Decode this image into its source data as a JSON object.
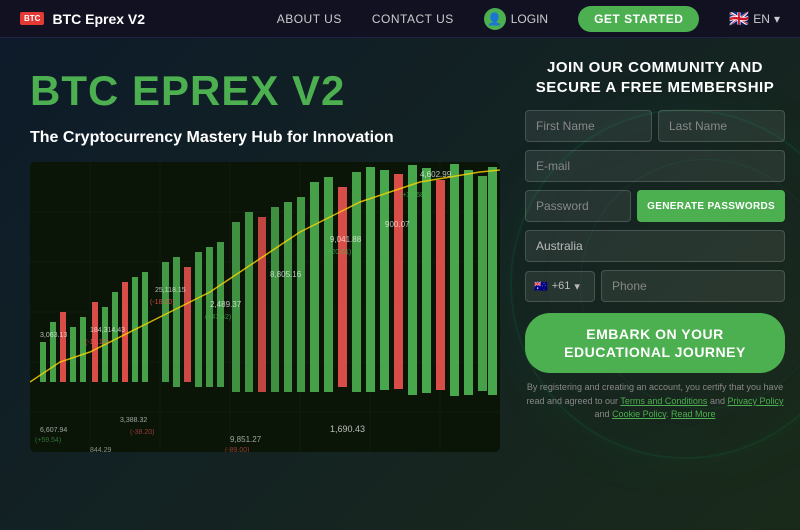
{
  "navbar": {
    "logo_icon": "BTC",
    "logo_text": "BTC Eprex V2",
    "links": [
      {
        "label": "ABOUT US",
        "id": "about-us"
      },
      {
        "label": "CONTACT US",
        "id": "contact-us"
      }
    ],
    "login_label": "LOGIN",
    "get_started_label": "GET STARTED",
    "lang_code": "EN",
    "lang_flag": "🇬🇧"
  },
  "hero": {
    "title": "BTC EPREX V2",
    "subtitle": "The Cryptocurrency Mastery Hub for Innovation"
  },
  "form": {
    "title": "JOIN OUR COMMUNITY AND SECURE A FREE MEMBERSHIP",
    "first_name_placeholder": "First Name",
    "last_name_placeholder": "Last Name",
    "email_placeholder": "E-mail",
    "password_placeholder": "Password",
    "generate_btn_label": "GENERATE PASSWORDS",
    "country_value": "Australia",
    "phone_code": "+61",
    "phone_placeholder": "Phone",
    "submit_label": "EMBARK ON YOUR EDUCATIONAL JOURNEY",
    "disclaimer": "By registering and creating an account, you certify that you have read and agreed to our",
    "terms_label": "Terms and Conditions",
    "privacy_label": "Privacy Policy",
    "cookie_label": "Cookie Policy",
    "read_more_label": "Read More",
    "disclaimer_connector1": "and",
    "disclaimer_connector2": "and"
  },
  "colors": {
    "green_accent": "#4caf50",
    "dark_bg": "#1a1a2e",
    "navbar_bg": "#111122"
  }
}
